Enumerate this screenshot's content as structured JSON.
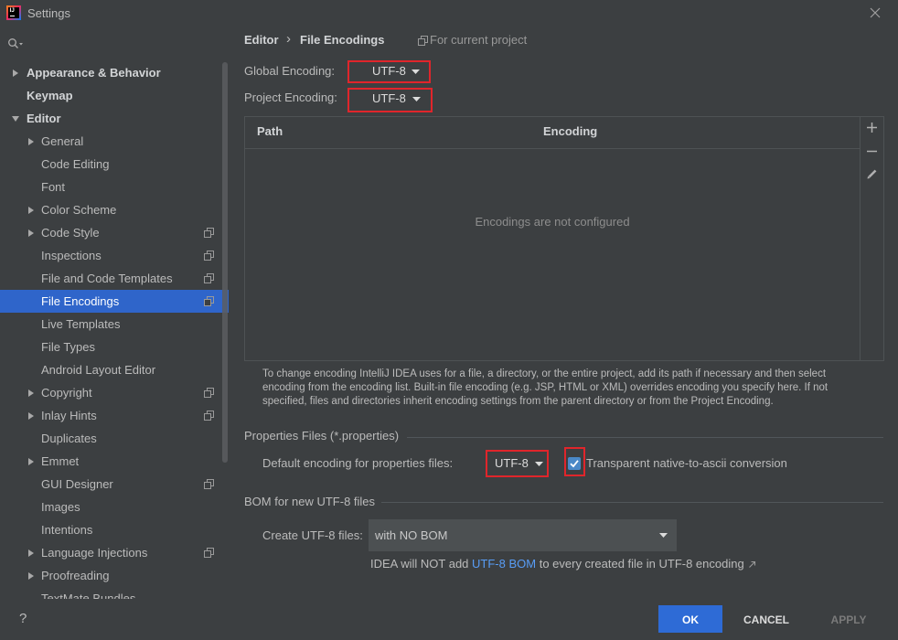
{
  "window": {
    "title": "Settings",
    "logo_text": "IJ",
    "app_icon": "intellij-idea-icon",
    "close_icon": "close-icon"
  },
  "search": {
    "icon": "search-icon",
    "value": ""
  },
  "sidebar": {
    "tree": [
      {
        "label": "Appearance & Behavior",
        "expander_icon": "chevron-right-icon"
      },
      {
        "label": "Keymap"
      },
      {
        "label": "Editor",
        "expander_icon": "chevron-down-icon",
        "children": [
          {
            "label": "General",
            "expander_icon": "chevron-right-icon"
          },
          {
            "label": "Code Editing"
          },
          {
            "label": "Font"
          },
          {
            "label": "Color Scheme",
            "expander_icon": "chevron-right-icon"
          },
          {
            "label": "Code Style",
            "expander_icon": "chevron-right-icon",
            "scope_icon": "project-scope-icon"
          },
          {
            "label": "Inspections",
            "scope_icon": "project-scope-icon"
          },
          {
            "label": "File and Code Templates",
            "scope_icon": "project-scope-icon"
          },
          {
            "label": "File Encodings",
            "scope_icon": "project-scope-icon",
            "selected": true
          },
          {
            "label": "Live Templates"
          },
          {
            "label": "File Types"
          },
          {
            "label": "Android Layout Editor"
          },
          {
            "label": "Copyright",
            "expander_icon": "chevron-right-icon",
            "scope_icon": "project-scope-icon"
          },
          {
            "label": "Inlay Hints",
            "expander_icon": "chevron-right-icon",
            "scope_icon": "project-scope-icon"
          },
          {
            "label": "Duplicates"
          },
          {
            "label": "Emmet",
            "expander_icon": "chevron-right-icon"
          },
          {
            "label": "GUI Designer",
            "scope_icon": "project-scope-icon"
          },
          {
            "label": "Images"
          },
          {
            "label": "Intentions"
          },
          {
            "label": "Language Injections",
            "expander_icon": "chevron-right-icon",
            "scope_icon": "project-scope-icon"
          },
          {
            "label": "Proofreading",
            "expander_icon": "chevron-right-icon"
          },
          {
            "label": "TextMate Bundles"
          }
        ]
      }
    ]
  },
  "breadcrumb": {
    "parent": "Editor",
    "separator": "›",
    "current": "File Encodings",
    "scope_icon": "project-scope-icon",
    "scope_label": "For current project"
  },
  "encodings": {
    "global_label": "Global Encoding:",
    "global_value": "UTF-8",
    "project_label": "Project Encoding:",
    "project_value": "UTF-8",
    "dropdown_icon": "triangle-down-icon"
  },
  "path_table": {
    "columns": [
      "Path",
      "Encoding"
    ],
    "rows": [],
    "empty_text": "Encodings are not configured",
    "toolbar": [
      {
        "icon": "plus-icon"
      },
      {
        "icon": "minus-icon"
      },
      {
        "icon": "pencil-icon"
      }
    ]
  },
  "description": {
    "lines": [
      "To change encoding IntelliJ IDEA uses for a file, a directory, or the entire project, add its path if necessary and then select",
      "encoding from the encoding list. Built-in file encoding (e.g. JSP, HTML or XML) overrides encoding you specify here. If not",
      "specified, files and directories inherit encoding settings from the parent directory or from the Project Encoding."
    ]
  },
  "properties_files": {
    "section_title": "Properties Files (*.properties)",
    "default_encoding_label": "Default encoding for properties files:",
    "default_encoding_value": "UTF-8",
    "native_to_ascii_label": "Transparent native-to-ascii conversion",
    "native_to_ascii_checked": true
  },
  "bom": {
    "section_title": "BOM for new UTF-8 files",
    "create_label": "Create UTF-8 files:",
    "create_value": "with NO BOM",
    "info_prefix": "IDEA will NOT add ",
    "info_link": "UTF-8 BOM",
    "info_suffix": " to every created file in UTF-8 encoding",
    "info_link_icon": "external-link-icon"
  },
  "footer": {
    "help_label": "?",
    "ok_label": "OK",
    "cancel_label": "CANCEL",
    "apply_label": "APPLY",
    "apply_enabled": false
  },
  "colors": {
    "background": "#3c3f41",
    "selection": "#2f65ca",
    "primary_button": "#2e6bd6",
    "link": "#589df6",
    "annotation_highlight": "#e0252b",
    "checkbox": "#4a88c7"
  }
}
